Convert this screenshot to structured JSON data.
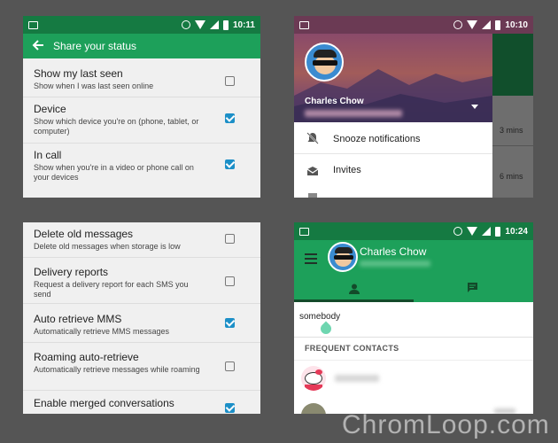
{
  "colors": {
    "green": "#1da05a",
    "dark_green": "#157a42",
    "checkbox_blue": "#1c8fc7",
    "background": "#555555"
  },
  "panel_a": {
    "status_time": "10:11",
    "back_icon": "arrow-left-icon",
    "title": "Share your status",
    "items": [
      {
        "title": "Show my last seen",
        "summary": "Show when I was last seen online",
        "checked": false
      },
      {
        "title": "Device",
        "summary": "Show which device you're on (phone, tablet, or computer)",
        "checked": true
      },
      {
        "title": "In call",
        "summary": "Show when you're in a video or phone call on your devices",
        "checked": true
      }
    ]
  },
  "panel_b": {
    "status_time": "10:10",
    "user_name": "Charles Chow",
    "menu": [
      {
        "label": "Snooze notifications",
        "icon": "snooze-bell-icon"
      },
      {
        "label": "Invites",
        "icon": "envelope-icon"
      }
    ],
    "times": [
      "3 mins",
      "6 mins"
    ]
  },
  "panel_c": {
    "items": [
      {
        "title": "Delete old messages",
        "summary": "Delete old messages when storage is low",
        "checked": false
      },
      {
        "title": "Delivery reports",
        "summary": "Request a delivery report for each SMS you send",
        "checked": false
      },
      {
        "title": "Auto retrieve MMS",
        "summary": "Automatically retrieve MMS messages",
        "checked": true
      },
      {
        "title": "Roaming auto-retrieve",
        "summary": "Automatically retrieve messages while roaming",
        "checked": false
      },
      {
        "title": "Enable merged conversations",
        "summary": "",
        "checked": true
      }
    ]
  },
  "panel_d": {
    "status_time": "10:24",
    "user_name": "Charles Chow",
    "menu_icon": "hamburger-menu-icon",
    "tabs": [
      {
        "icon": "person-icon"
      },
      {
        "icon": "chat-icon"
      }
    ],
    "search_value": "somebody",
    "section_header": "FREQUENT CONTACTS"
  },
  "watermark": "ChromLoop.com"
}
